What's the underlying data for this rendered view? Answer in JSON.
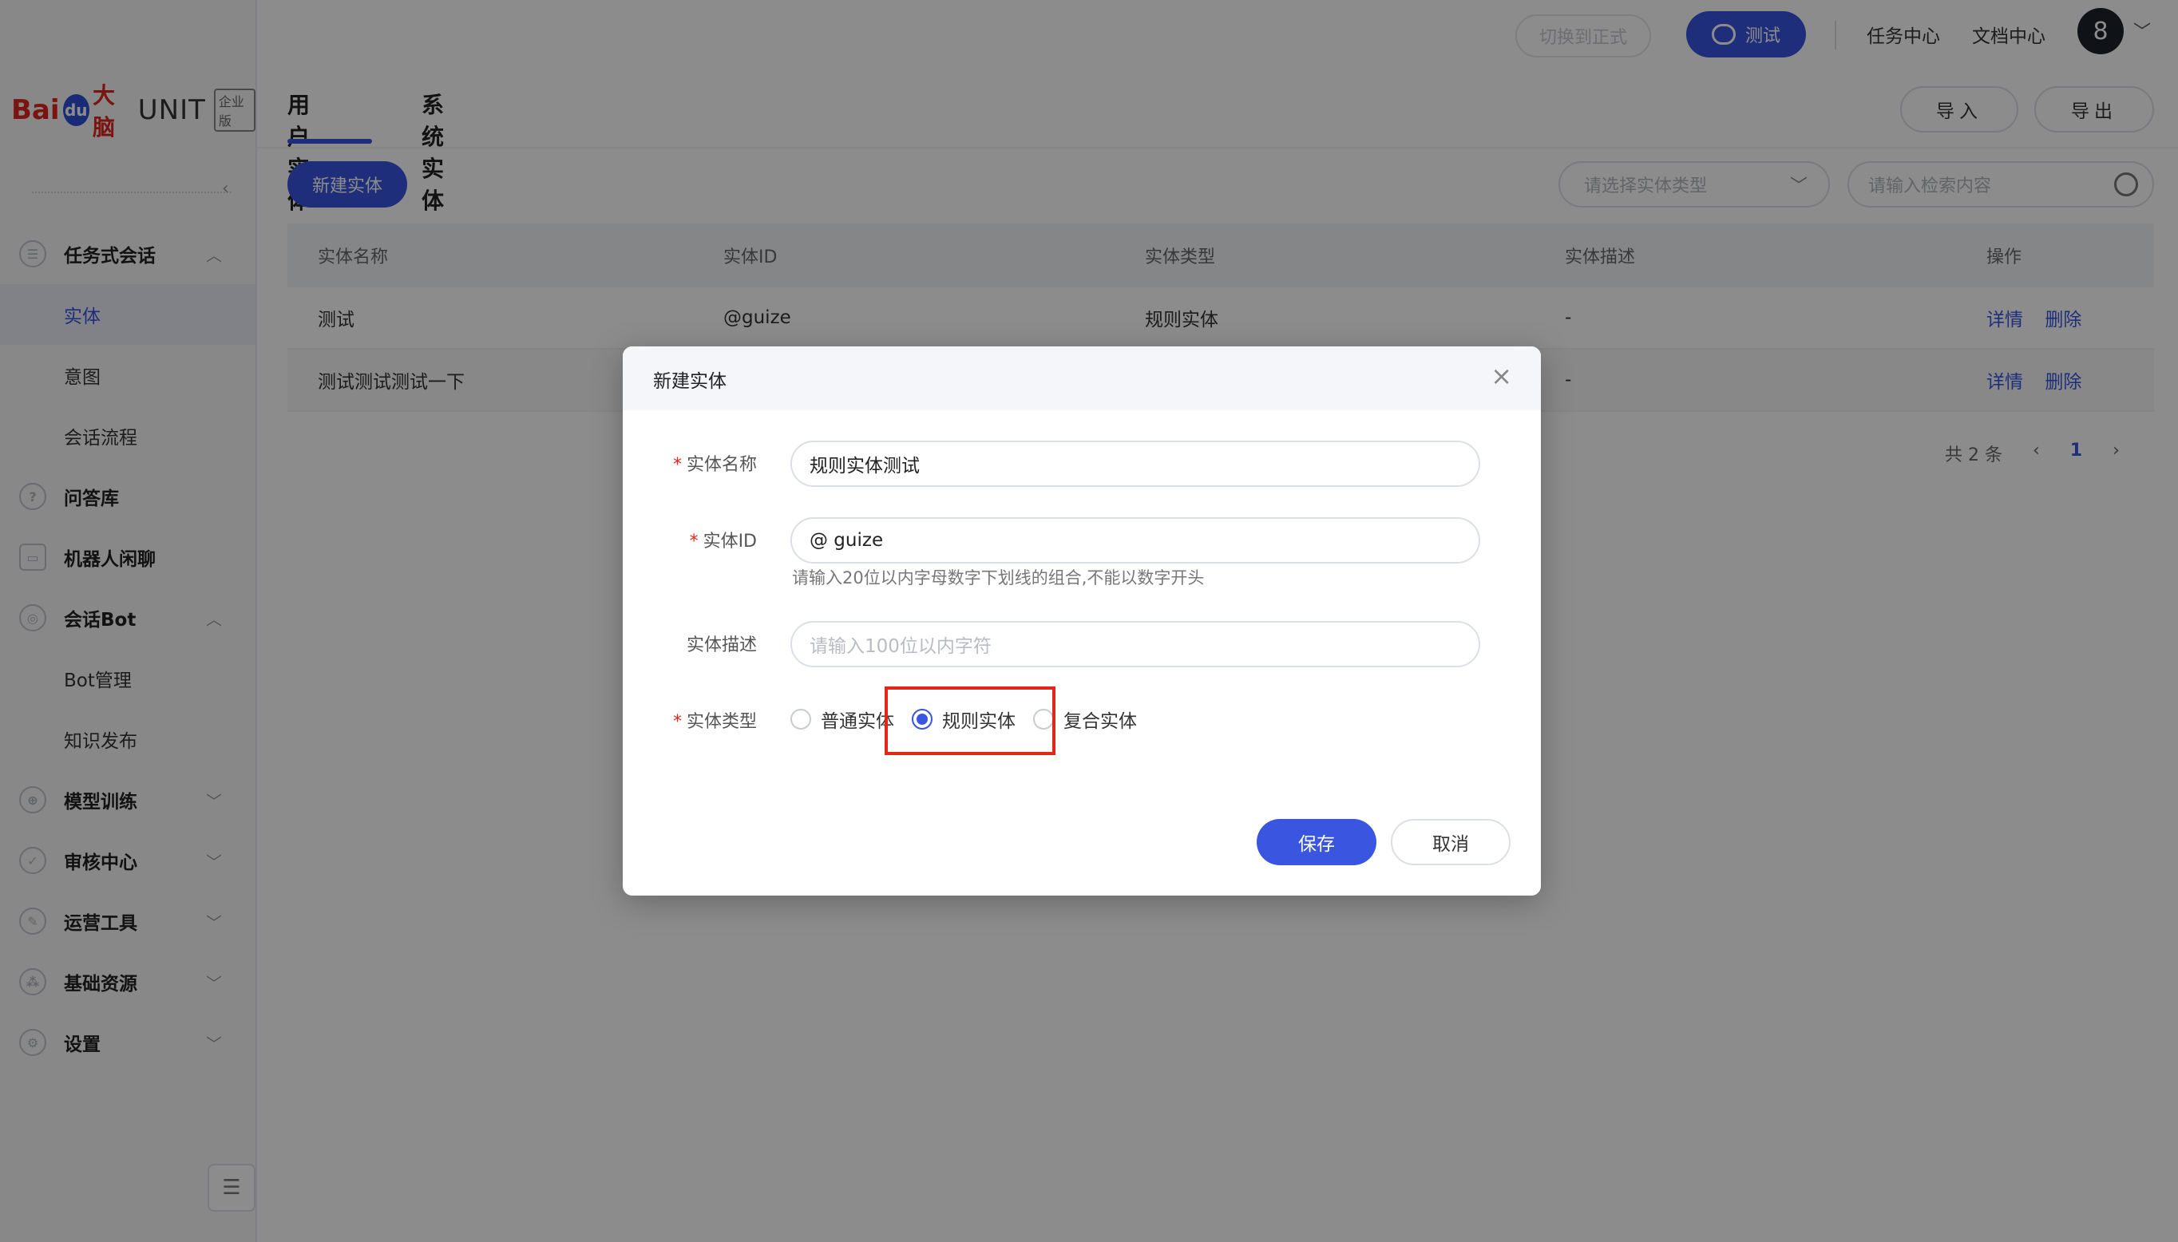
{
  "brand": {
    "bai": "Bai",
    "du": "du",
    "brain": "大脑",
    "unit": "UNIT",
    "edition": "企业版"
  },
  "sidebar": {
    "items": [
      {
        "label": "任务式会话",
        "icon": "task-tree-icon",
        "expanded": true
      },
      {
        "label": "实体",
        "sub": true,
        "active": true
      },
      {
        "label": "意图",
        "sub": true
      },
      {
        "label": "会话流程",
        "sub": true
      },
      {
        "label": "问答库",
        "icon": "question-icon"
      },
      {
        "label": "机器人闲聊",
        "icon": "chat-icon"
      },
      {
        "label": "会话Bot",
        "icon": "bot-icon",
        "expanded": true
      },
      {
        "label": "Bot管理",
        "sub": true
      },
      {
        "label": "知识发布",
        "sub": true
      },
      {
        "label": "模型训练",
        "icon": "train-icon"
      },
      {
        "label": "审核中心",
        "icon": "shield-icon"
      },
      {
        "label": "运营工具",
        "icon": "tool-icon"
      },
      {
        "label": "基础资源",
        "icon": "resource-icon"
      },
      {
        "label": "设置",
        "icon": "settings-icon"
      }
    ]
  },
  "topbar": {
    "switch_label": "切换到正式",
    "test_label": "测试",
    "task_center": "任务中心",
    "doc_center": "文档中心",
    "avatar_text": "8"
  },
  "tabs": [
    {
      "label": "用户实体",
      "active": true
    },
    {
      "label": "系统实体"
    }
  ],
  "actions": {
    "import": "导入",
    "export": "导出",
    "new_entity": "新建实体"
  },
  "filters": {
    "type_placeholder": "请选择实体类型",
    "search_placeholder": "请输入检索内容"
  },
  "table": {
    "headers": [
      "实体名称",
      "实体ID",
      "实体类型",
      "实体描述",
      "操作"
    ],
    "rows": [
      {
        "name": "测试",
        "id": "@guize",
        "type": "规则实体",
        "desc": "-",
        "detail": "详情",
        "delete": "删除"
      },
      {
        "name": "测试测试测试一下",
        "id": "",
        "type": "",
        "desc": "-",
        "detail": "详情",
        "delete": "删除"
      }
    ]
  },
  "pager": {
    "total": "共 2 条",
    "prev": "‹",
    "page": "1",
    "next": "›"
  },
  "modal": {
    "title": "新建实体",
    "name_label": "实体名称",
    "name_value": "规则实体测试",
    "id_label": "实体ID",
    "id_value": "@ guize",
    "id_hint": "请输入20位以内字母数字下划线的组合,不能以数字开头",
    "desc_label": "实体描述",
    "desc_placeholder": "请输入100位以内字符",
    "type_label": "实体类型",
    "type_options": [
      "普通实体",
      "规则实体",
      "复合实体"
    ],
    "type_selected": "规则实体",
    "save": "保存",
    "cancel": "取消"
  },
  "colors": {
    "accent": "#3a55e0",
    "highlight": "#e1261c"
  }
}
